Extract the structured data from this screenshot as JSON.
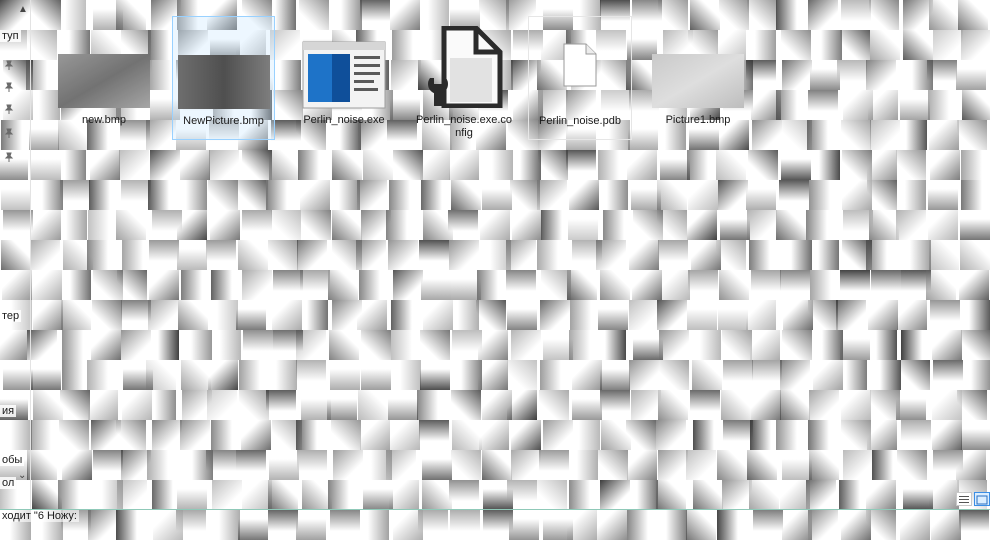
{
  "nav": {
    "labels": [
      "туп",
      "тер",
      "ия",
      "обы",
      "ол"
    ],
    "scroll_up": "▲",
    "scroll_down": "⌄"
  },
  "files": [
    {
      "name": "new.bmp",
      "icon": "bitmap-thumbnail-icon",
      "selected": false
    },
    {
      "name": "NewPicture.bmp",
      "icon": "bitmap-thumbnail-icon",
      "selected": true
    },
    {
      "name": "Perlin_noise.exe",
      "icon": "application-window-icon",
      "selected": false
    },
    {
      "name": "Perlin_noise.exe.config",
      "icon": "config-file-wrench-icon",
      "selected": false
    },
    {
      "name": "Perlin_noise.pdb",
      "icon": "blank-document-icon",
      "selected": false
    },
    {
      "name": "Picture1.bmp",
      "icon": "bitmap-thumbnail-icon",
      "selected": false
    }
  ],
  "status": {
    "text": "ходит \"6 Ножу:"
  },
  "view_buttons": {
    "details": "details-view-icon",
    "large_icons": "large-icons-view-icon"
  }
}
